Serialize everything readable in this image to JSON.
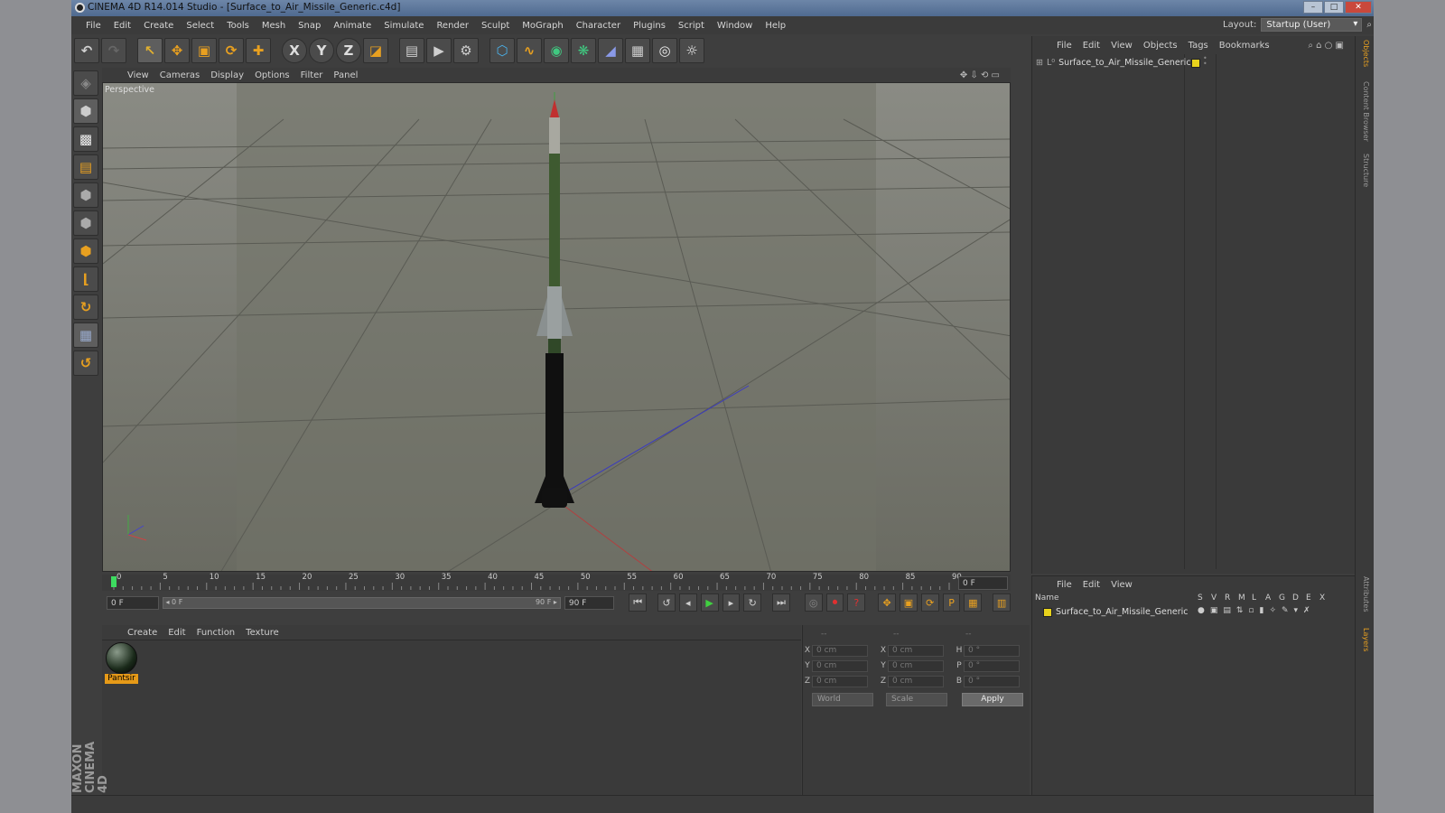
{
  "window": {
    "title": "CINEMA 4D R14.014 Studio - [Surface_to_Air_Missile_Generic.c4d]",
    "min": "–",
    "max": "□",
    "close": "✕"
  },
  "menu": [
    "File",
    "Edit",
    "Create",
    "Select",
    "Tools",
    "Mesh",
    "Snap",
    "Animate",
    "Simulate",
    "Render",
    "Sculpt",
    "MoGraph",
    "Character",
    "Plugins",
    "Script",
    "Window",
    "Help"
  ],
  "layout": {
    "label": "Layout:",
    "value": "Startup (User)"
  },
  "toolbar": {
    "undo": "↶",
    "redo": "↷",
    "live": "↖",
    "move": "✥",
    "scale": "▣",
    "rotate": "⟳",
    "add": "✚",
    "x": "X",
    "y": "Y",
    "z": "Z",
    "coord": "◪",
    "render_view": "▤",
    "render": "▶",
    "render_settings": "⚙",
    "cube": "⬡",
    "spline": "∿",
    "nurbs": "◉",
    "array": "❋",
    "deform": "◢",
    "scene": "▦",
    "camera": "◎",
    "light": "☼"
  },
  "left_tools": [
    "◈",
    "⬢",
    "▩",
    "▤",
    "⬢",
    "⬢",
    "⬢",
    "⌊",
    "↻",
    "▦",
    "↺"
  ],
  "viewport": {
    "menu": [
      "View",
      "Cameras",
      "Display",
      "Options",
      "Filter",
      "Panel"
    ],
    "label": "Perspective",
    "icons": "✥ ⇩ ⟲ ▭"
  },
  "timeline": {
    "ticks": [
      "0",
      "5",
      "10",
      "15",
      "20",
      "25",
      "30",
      "35",
      "40",
      "45",
      "50",
      "55",
      "60",
      "65",
      "70",
      "75",
      "80",
      "85",
      "90"
    ],
    "frame_end": "0 F"
  },
  "timectl": {
    "start": "0 F",
    "slider_start": "◂ 0 F",
    "slider_end": "90 F ▸",
    "end": "90 F",
    "btns": [
      "⏮",
      "↺",
      "◂",
      "▶",
      "▸",
      "↻",
      "⏭"
    ],
    "rec": [
      "◎",
      "⏺",
      "?"
    ],
    "keys": [
      "✥",
      "▣",
      "⟳",
      "P",
      "▦",
      "▥"
    ]
  },
  "material": {
    "menu": [
      "Create",
      "Edit",
      "Function",
      "Texture"
    ],
    "name": "Pantsir"
  },
  "attributes": {
    "header": [
      "--",
      "--",
      "--"
    ],
    "rows": [
      [
        "X",
        "0 cm",
        "X",
        "0 cm",
        "H",
        "0 °"
      ],
      [
        "Y",
        "0 cm",
        "Y",
        "0 cm",
        "P",
        "0 °"
      ],
      [
        "Z",
        "0 cm",
        "Z",
        "0 cm",
        "B",
        "0 °"
      ]
    ],
    "world": "World",
    "scale": "Scale",
    "apply": "Apply"
  },
  "objects": {
    "menu": [
      "File",
      "Edit",
      "View",
      "Objects",
      "Tags",
      "Bookmarks"
    ],
    "item": "Surface_to_Air_Missile_Generic",
    "icons": "⌕ ⌂ ○ ▣"
  },
  "layers": {
    "menu": [
      "File",
      "Edit",
      "View"
    ],
    "headers": [
      "Name",
      "S",
      "V",
      "R",
      "M",
      "L",
      "A",
      "G",
      "D",
      "E",
      "X"
    ],
    "item": "Surface_to_Air_Missile_Generic"
  },
  "side_tabs": [
    "Objects",
    "Content Browser",
    "Structure",
    "Attributes",
    "Layers"
  ],
  "brand": "MAXON CINEMA 4D",
  "colors": {
    "tag": "#e8d21c",
    "material_label": "#e69a18",
    "frame_marker": "#3ddc60"
  }
}
